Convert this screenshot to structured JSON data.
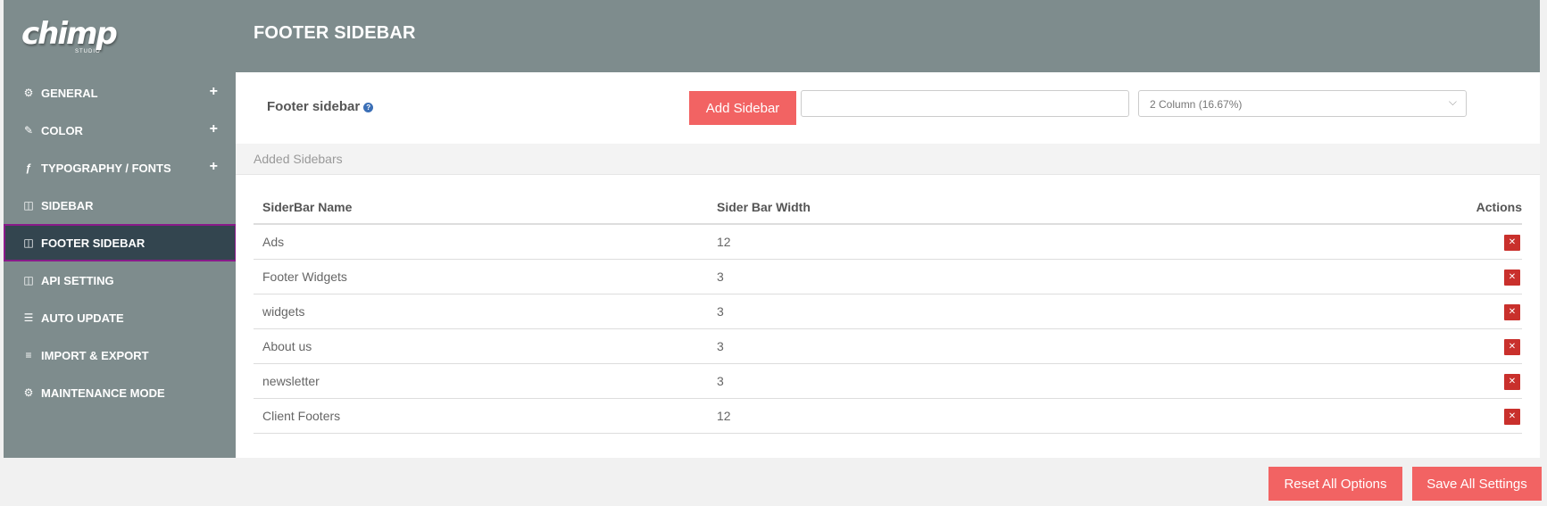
{
  "app": {
    "logo_text": "chimp",
    "logo_sub": "STUDIO"
  },
  "header": {
    "title": "FOOTER SIDEBAR"
  },
  "sidebar": {
    "items": [
      {
        "label": "GENERAL",
        "icon": "gear-icon",
        "expandable": true
      },
      {
        "label": "COLOR",
        "icon": "magic-wand-icon",
        "expandable": true
      },
      {
        "label": "TYPOGRAPHY / FONTS",
        "icon": "font-icon",
        "expandable": true
      },
      {
        "label": "SIDEBAR",
        "icon": "columns-icon",
        "expandable": false
      },
      {
        "label": "FOOTER SIDEBAR",
        "icon": "columns-icon",
        "expandable": false,
        "active": true
      },
      {
        "label": "API SETTING",
        "icon": "columns-icon",
        "expandable": false
      },
      {
        "label": "AUTO UPDATE",
        "icon": "server-icon",
        "expandable": false
      },
      {
        "label": "IMPORT & EXPORT",
        "icon": "database-icon",
        "expandable": false
      },
      {
        "label": "MAINTENANCE MODE",
        "icon": "cogs-icon",
        "expandable": false
      }
    ]
  },
  "form": {
    "label": "Footer sidebar",
    "add_button": "Add Sidebar",
    "name_input_value": "",
    "width_select_value": "2 Column (16.67%)"
  },
  "added": {
    "title": "Added Sidebars"
  },
  "table": {
    "headers": [
      "SiderBar Name",
      "Sider Bar Width",
      "Actions"
    ],
    "rows": [
      {
        "name": "Ads",
        "width": "12"
      },
      {
        "name": "Footer Widgets",
        "width": "3"
      },
      {
        "name": "widgets",
        "width": "3"
      },
      {
        "name": "About us",
        "width": "3"
      },
      {
        "name": "newsletter",
        "width": "3"
      },
      {
        "name": "Client Footers",
        "width": "12"
      }
    ]
  },
  "footer": {
    "reset_label": "Reset All Options",
    "save_label": "Save All Settings"
  },
  "colors": {
    "accent": "#f26363",
    "sidebar_bg": "#7e8c8d",
    "active_bg": "#33454f",
    "delete": "#c9302c"
  }
}
